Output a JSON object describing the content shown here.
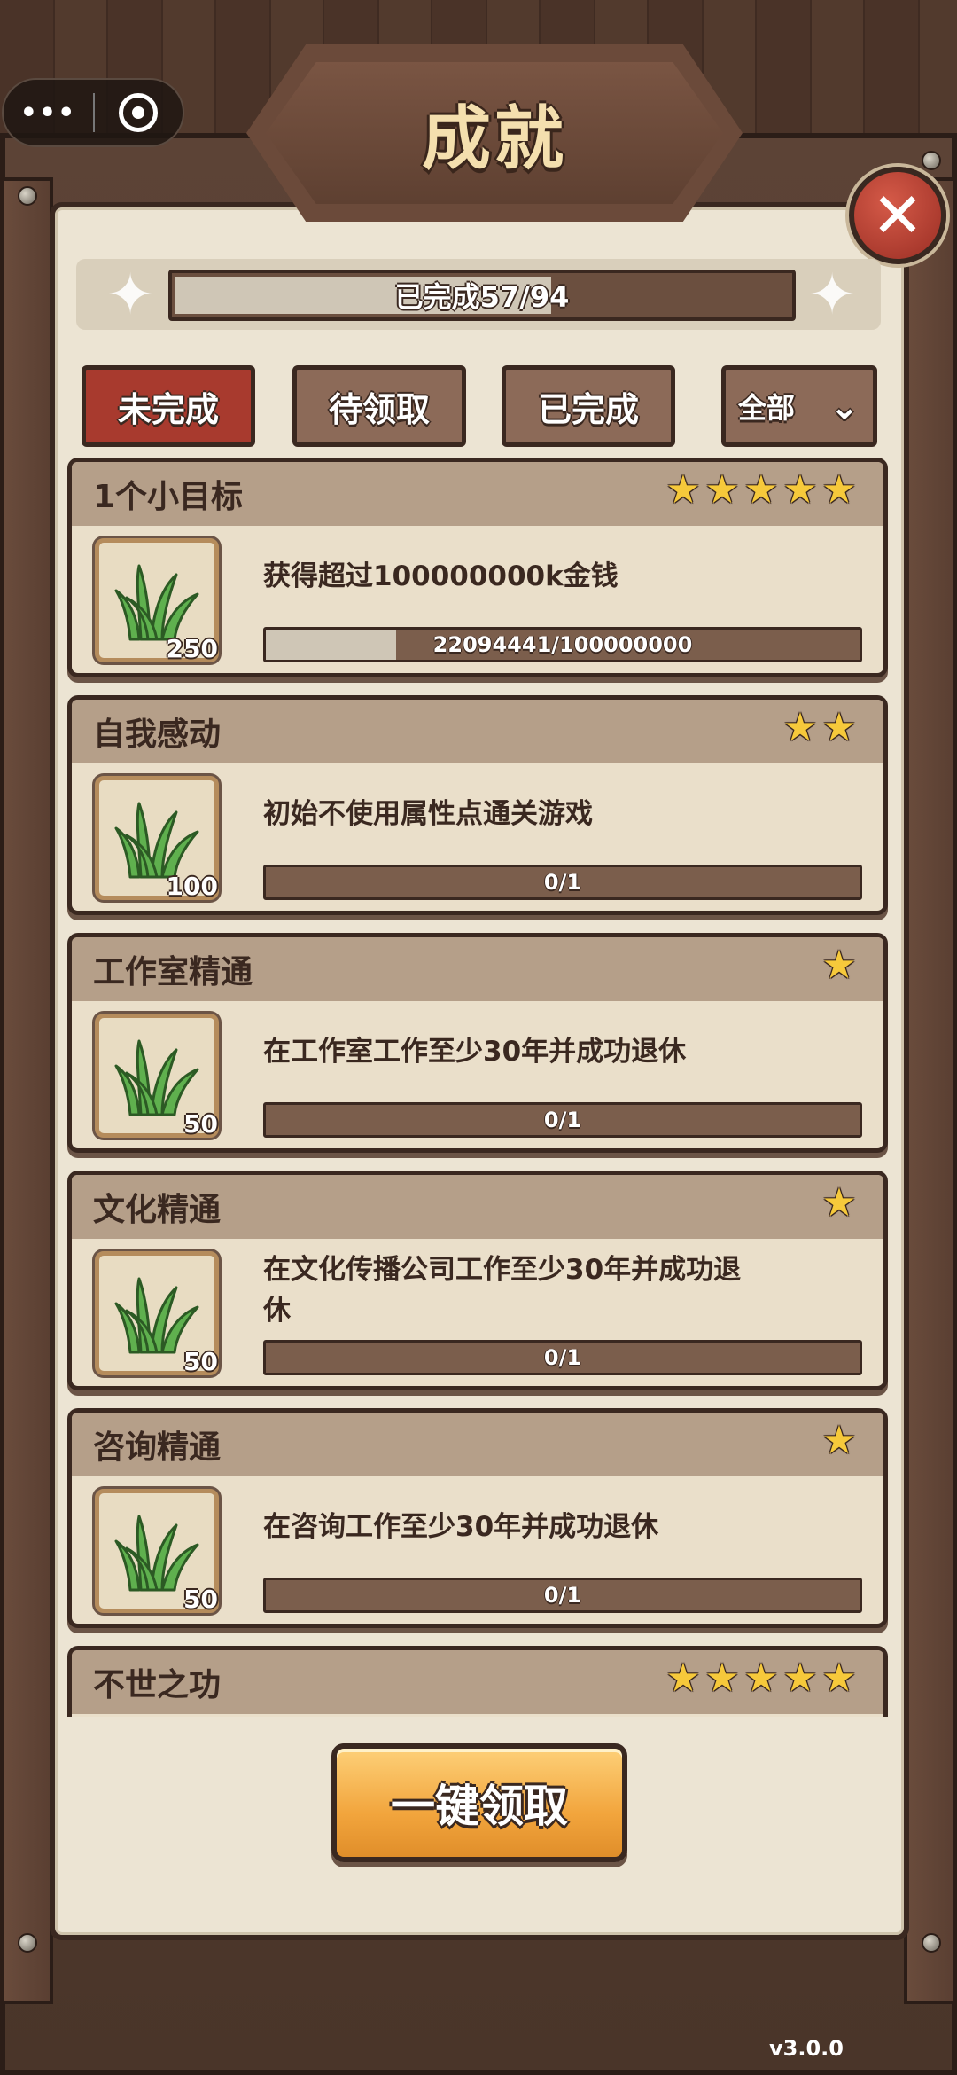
{
  "capsule": {
    "more_icon": "more-dots-icon",
    "close_icon": "target-close-icon"
  },
  "title": "成就",
  "progress": {
    "label": "已完成57/94",
    "completed": 57,
    "total": 94
  },
  "tabs": [
    {
      "label": "未完成",
      "active": true
    },
    {
      "label": "待领取",
      "active": false
    },
    {
      "label": "已完成",
      "active": false
    }
  ],
  "filter": {
    "label": "全部"
  },
  "achievements": [
    {
      "title": "1个小目标",
      "stars": 5,
      "reward": "250",
      "desc": "获得超过100000000k金钱",
      "progress_text": "22094441/100000000",
      "progress": 0.22
    },
    {
      "title": "自我感动",
      "stars": 2,
      "reward": "100",
      "desc": "初始不使用属性点通关游戏",
      "progress_text": "0/1",
      "progress": 0
    },
    {
      "title": "工作室精通",
      "stars": 1,
      "reward": "50",
      "desc": "在工作室工作至少30年并成功退休",
      "progress_text": "0/1",
      "progress": 0
    },
    {
      "title": "文化精通",
      "stars": 1,
      "reward": "50",
      "desc": "在文化传播公司工作至少30年并成功退休",
      "progress_text": "0/1",
      "progress": 0
    },
    {
      "title": "咨询精通",
      "stars": 1,
      "reward": "50",
      "desc": "在咨询工作至少30年并成功退休",
      "progress_text": "0/1",
      "progress": 0
    },
    {
      "title": "不世之功",
      "stars": 5,
      "reward": "",
      "desc": "",
      "progress_text": "",
      "progress": 0
    }
  ],
  "claim_all": "一键领取",
  "version": "v3.0.0",
  "colors": {
    "accent_red": "#a83a2e",
    "wood_dark": "#3a2820",
    "star": "#f6c93b",
    "button_orange": "#f2a53d"
  }
}
